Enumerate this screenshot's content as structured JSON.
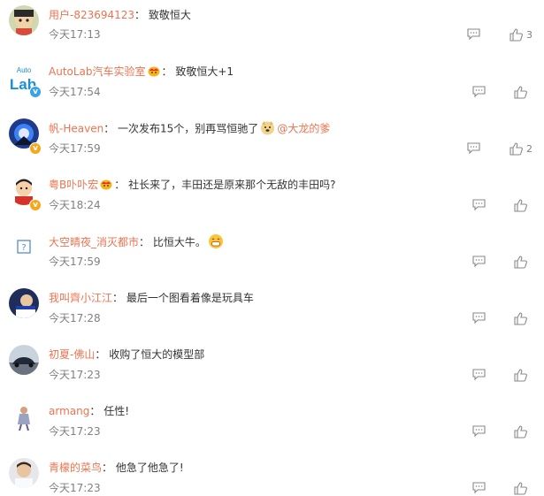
{
  "comments": [
    {
      "user": "用户-823694123",
      "text": "致敬恒大",
      "time": "今天17:13",
      "likes": "3"
    },
    {
      "user": "AutoLab汽车实验室",
      "text": "致敬恒大+1",
      "time": "今天17:54",
      "likes": "",
      "avatar_text_top": "Auto",
      "avatar_text_bottom": "Lab"
    },
    {
      "user": "帆-Heaven",
      "text": "一次发布15个，别再骂恒驰了",
      "mention": "@大龙的爹",
      "time": "今天17:59",
      "likes": "2"
    },
    {
      "user": "粤B卟卟宏",
      "text": "社长来了，丰田还是原来那个无敌的丰田吗?",
      "time": "今天18:24",
      "likes": ""
    },
    {
      "user": "大空晴夜_消灭都市",
      "text": "比恒大牛。",
      "time": "今天17:59",
      "likes": "",
      "avatar_text": "?"
    },
    {
      "user": "我叫齊小江江",
      "text": "最后一个图看着像是玩具车",
      "time": "今天17:28",
      "likes": ""
    },
    {
      "user": "初夏-佛山",
      "text": "收购了恒大的模型部",
      "time": "今天17:23",
      "likes": ""
    },
    {
      "user": "armang",
      "text": "任性!",
      "time": "今天17:23",
      "likes": ""
    },
    {
      "user": "青檬的菜鸟",
      "text": "他急了他急了!",
      "time": "今天17:23",
      "likes": ""
    }
  ],
  "colors": {
    "username": "#eb7350",
    "time": "#808080",
    "icon": "#888888"
  }
}
